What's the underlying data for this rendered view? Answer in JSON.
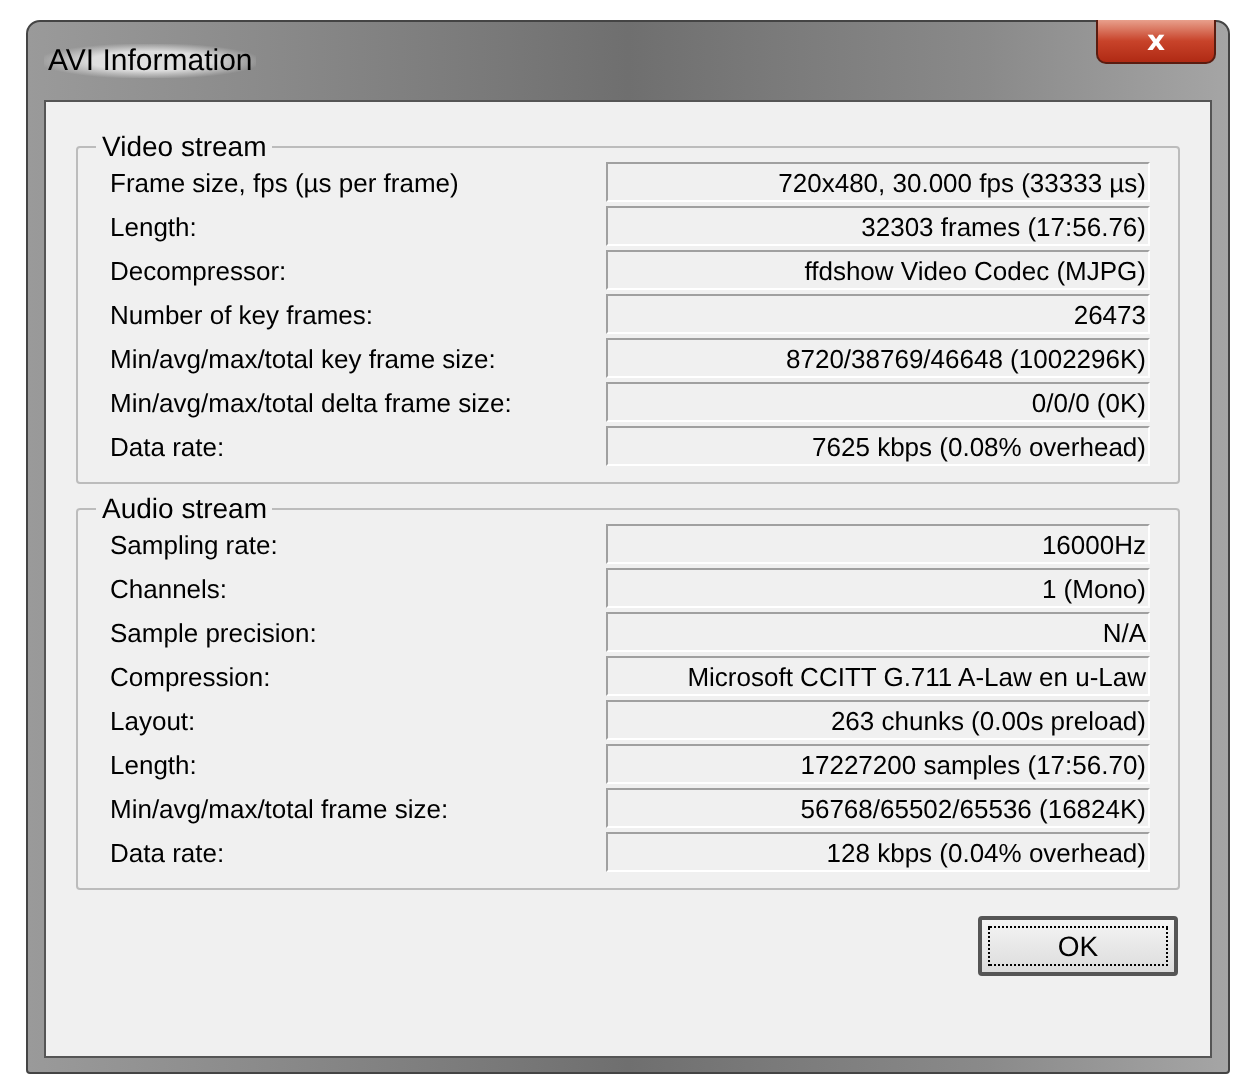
{
  "window": {
    "title": "AVI Information",
    "close_label": "x"
  },
  "groups": [
    {
      "title": "Video stream",
      "rows": [
        {
          "label": "Frame size, fps (µs per frame)",
          "value": "720x480, 30.000 fps (33333 µs)"
        },
        {
          "label": "Length:",
          "value": "32303 frames (17:56.76)"
        },
        {
          "label": "Decompressor:",
          "value": "ffdshow Video Codec (MJPG)"
        },
        {
          "label": "Number of key frames:",
          "value": "26473"
        },
        {
          "label": "Min/avg/max/total key frame size:",
          "value": "8720/38769/46648 (1002296K)"
        },
        {
          "label": "Min/avg/max/total delta frame size:",
          "value": "0/0/0 (0K)"
        },
        {
          "label": "Data rate:",
          "value": "7625 kbps (0.08% overhead)"
        }
      ]
    },
    {
      "title": "Audio stream",
      "rows": [
        {
          "label": "Sampling rate:",
          "value": "16000Hz"
        },
        {
          "label": "Channels:",
          "value": "1 (Mono)"
        },
        {
          "label": "Sample precision:",
          "value": "N/A"
        },
        {
          "label": "Compression:",
          "value": "Microsoft CCITT G.711 A-Law en u-Law"
        },
        {
          "label": "Layout:",
          "value": "263 chunks (0.00s preload)"
        },
        {
          "label": "Length:",
          "value": "17227200 samples (17:56.70)"
        },
        {
          "label": "Min/avg/max/total frame size:",
          "value": "56768/65502/65536 (16824K)"
        },
        {
          "label": "Data rate:",
          "value": "128 kbps (0.04% overhead)"
        }
      ]
    }
  ],
  "ok_button": {
    "label": "OK",
    "focused": true
  }
}
